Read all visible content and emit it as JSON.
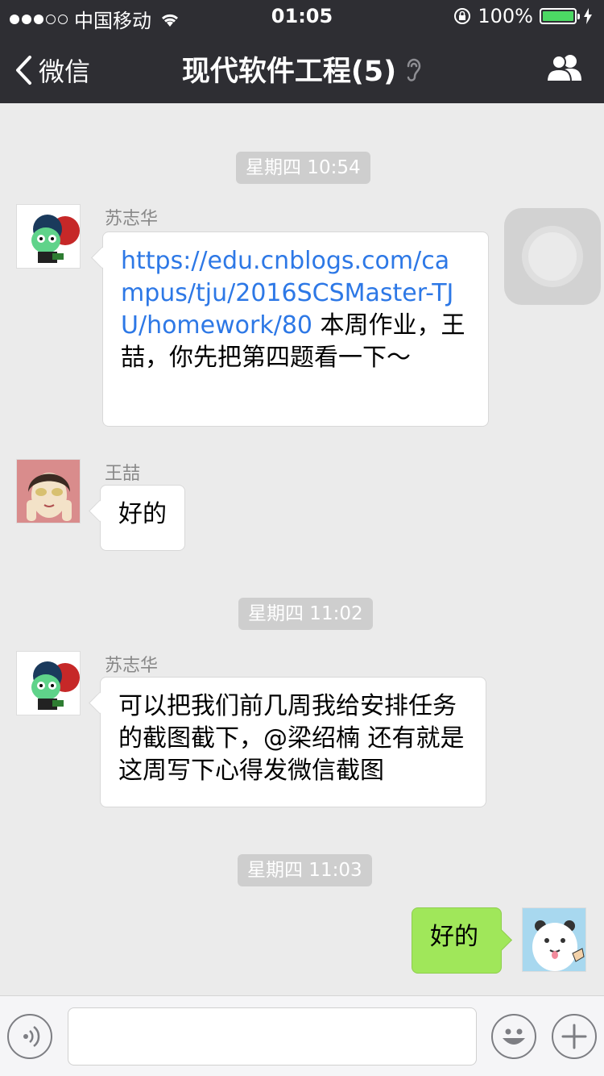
{
  "status_bar": {
    "carrier": "中国移动",
    "time": "01:05",
    "battery": "100%",
    "signal_bars_filled": 3,
    "signal_bars_total": 5
  },
  "nav": {
    "back_label": "微信",
    "title": "现代软件工程(5)"
  },
  "messages": {
    "t1": "星期四 10:54",
    "m1": {
      "sender": "苏志华",
      "link": "https://edu.cnblogs.com/campus/tju/2016SCSMaster-TJU/homework/80",
      "text": " 本周作业，王喆，你先把第四题看一下～"
    },
    "m2": {
      "sender": "王喆",
      "text": "好的"
    },
    "t2": "星期四 11:02",
    "m3": {
      "sender": "苏志华",
      "text": "可以把我们前几周我给安排任务的截图截下，@梁绍楠 还有就是这周写下心得发微信截图"
    },
    "t3": "星期四 11:03",
    "m4": {
      "text": "好的"
    }
  },
  "icons": {
    "back": "chevron-left-icon",
    "ear": "ear-icon",
    "group": "group-members-icon",
    "voice": "voice-icon",
    "emoji": "emoji-icon",
    "plus": "plus-icon"
  },
  "colors": {
    "header": "#2e2e33",
    "chat_bg": "#ebebeb",
    "my_bubble": "#a0e75a",
    "link": "#2d78e6",
    "battery": "#4cd964"
  }
}
